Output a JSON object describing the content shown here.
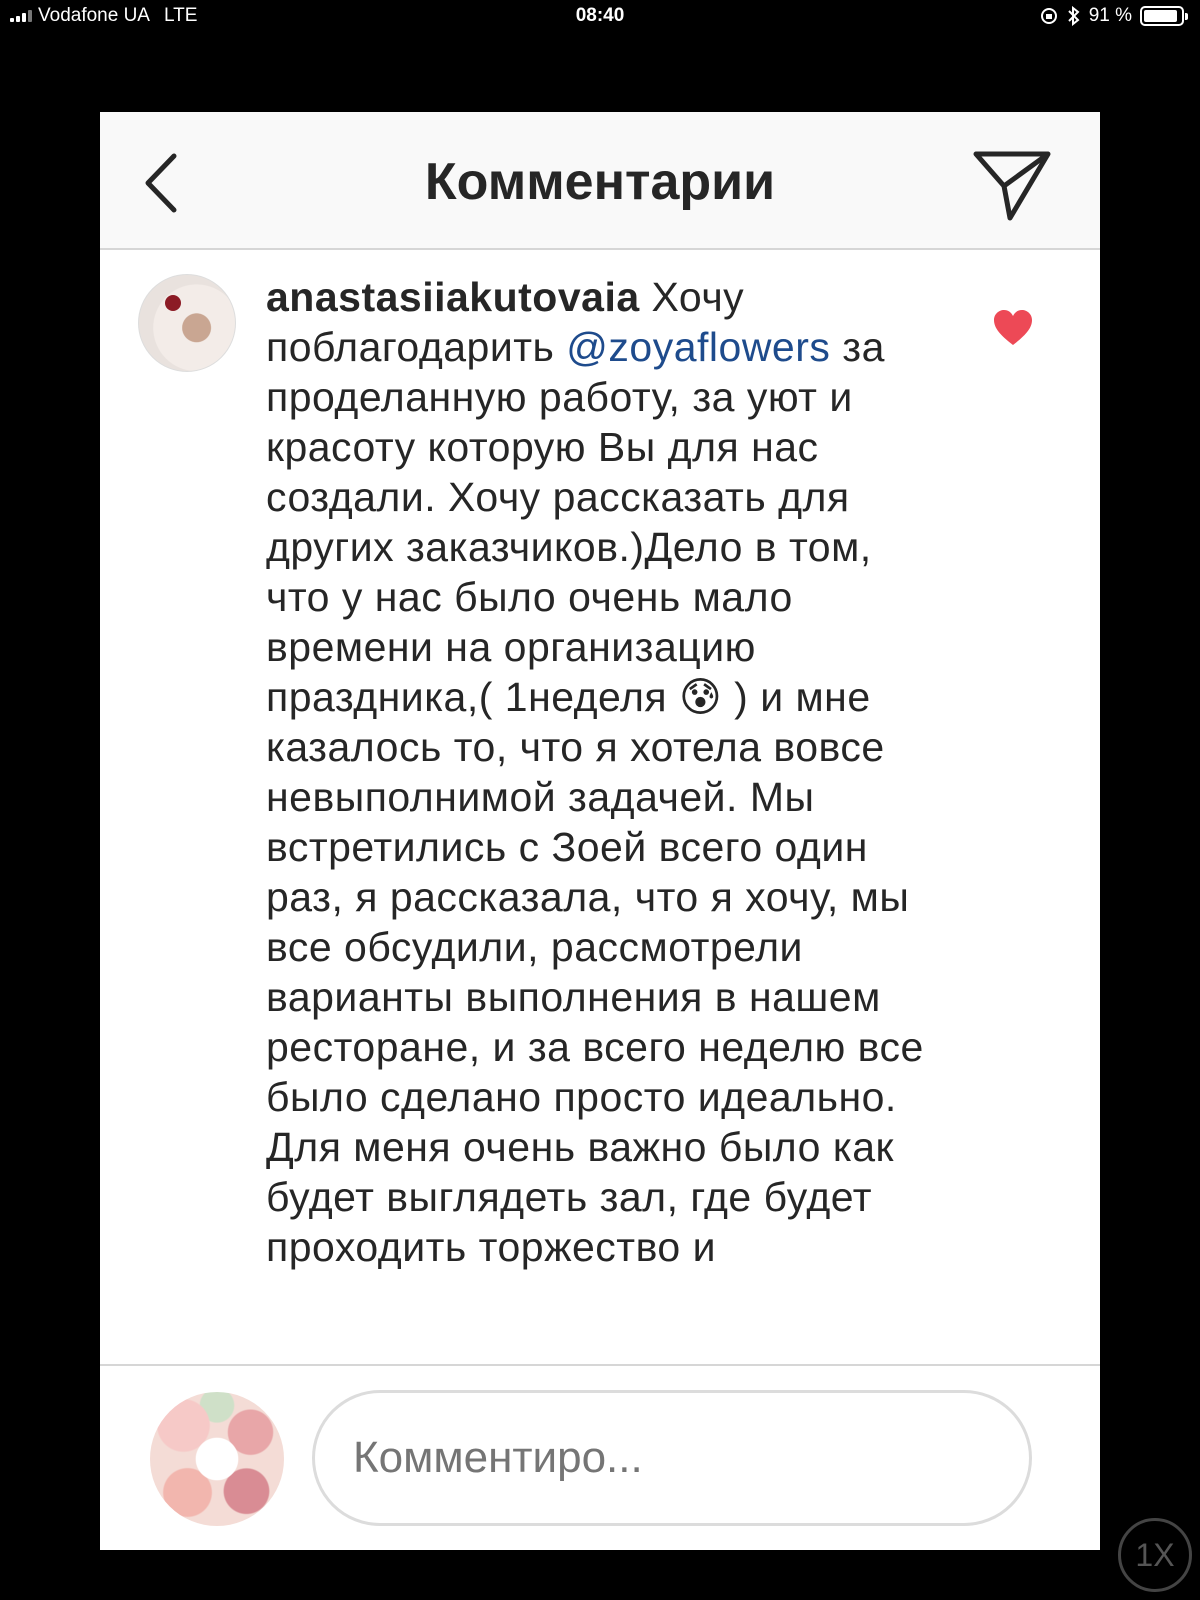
{
  "status_bar": {
    "carrier": "Vodafone UA",
    "network": "LTE",
    "time": "08:40",
    "battery_text": "91 %",
    "battery_level": 0.91
  },
  "header": {
    "title": "Комментарии",
    "back_icon": "chevron-left-icon",
    "send_icon": "paper-plane-icon"
  },
  "comment": {
    "username": "anastasiiakutovaia",
    "text_intro": " Хочу поблагодарить ",
    "mention": "@zoyaflowers",
    "text_part1": " за проделанную работу, за уют и красоту которую Вы для нас создали. Хочу рассказать для других заказчиков.)Дело в том, что у нас было очень мало времени на организацию праздника,( 1неделя ",
    "emoji": "😰",
    "text_part2": " ) и мне казалось то, что я хотела вовсе невыполнимой задачей. Мы встретились с Зоей всего один раз, я рассказала, что я хочу, мы все обсудили, рассмотрели варианты выполнения в нашем ресторане, и за всего неделю все было сделано просто идеально. Для меня очень важно было как будет выглядеть зал, где будет проходить торжество и",
    "liked": true
  },
  "composer": {
    "placeholder": "Комментиро..."
  },
  "zoom": {
    "label": "1X"
  },
  "colors": {
    "accent_like": "#ed4956",
    "mention": "#1e4b8c",
    "text": "#262626"
  }
}
